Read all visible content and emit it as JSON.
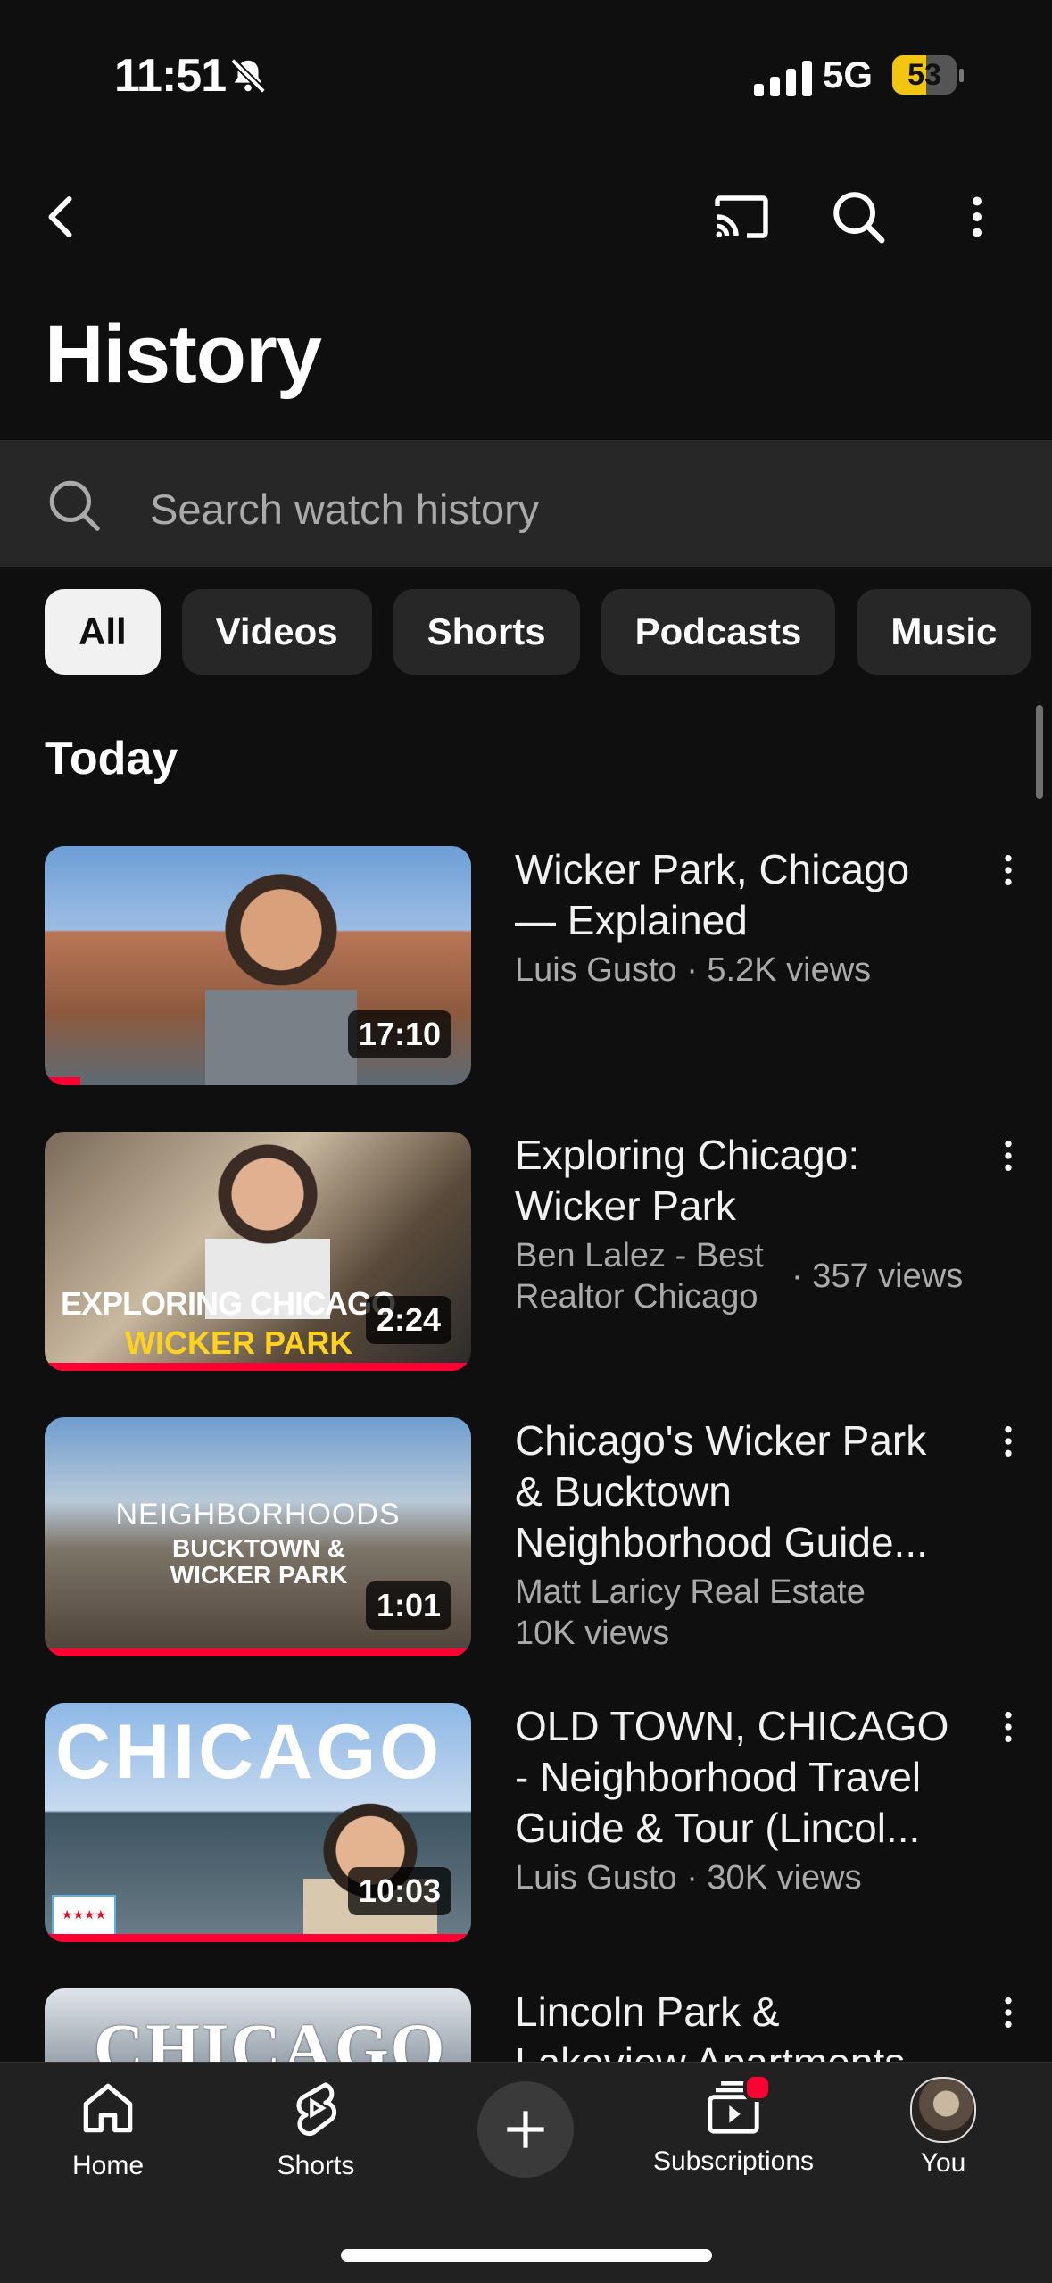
{
  "status_bar": {
    "time": "11:51",
    "network": "5G",
    "battery": "53",
    "battery_level": 0.53
  },
  "header": {
    "title": "History"
  },
  "search": {
    "placeholder": "Search watch history"
  },
  "chips": [
    "All",
    "Videos",
    "Shorts",
    "Podcasts",
    "Music"
  ],
  "section": {
    "today": "Today"
  },
  "videos": [
    {
      "title_line1": "Wicker Park, Chicago",
      "title_line2": "— Explained",
      "title_line3": "",
      "meta1": "Luis Gusto · 5.2K views",
      "meta2": "",
      "duration": "17:10",
      "thumb_text": ""
    },
    {
      "title_line1": "Exploring Chicago:",
      "title_line2": "Wicker Park",
      "title_line3": "",
      "channel_line1": "Ben Lalez - Best",
      "channel_line2": "Realtor Chicago",
      "views": "· 357 views",
      "duration": "2:24",
      "thumb_text": "EXPLORING CHICAGO",
      "thumb_sub": "WICKER PARK"
    },
    {
      "title_line1": "Chicago's Wicker Park",
      "title_line2": "& Bucktown",
      "title_line3": "Neighborhood Guide...",
      "meta1": "Matt Laricy Real Estate",
      "meta2": "10K views",
      "duration": "1:01",
      "thumb_text": "NEIGHBORHOODS",
      "thumb_sub": "BUCKTOWN & WICKER PARK"
    },
    {
      "title_line1": "OLD TOWN, CHICAGO",
      "title_line2": "- Neighborhood Travel",
      "title_line3": "Guide & Tour (Lincol...",
      "meta1": "Luis Gusto · 30K views",
      "meta2": "",
      "duration": "10:03",
      "thumb_text": "CHICAGO"
    },
    {
      "title_line1": "Lincoln Park &",
      "title_line2": "Lakeview Apartments",
      "thumb_text": "CHICAGO"
    }
  ],
  "nav": {
    "home": "Home",
    "shorts": "Shorts",
    "subscriptions": "Subscriptions",
    "you": "You"
  },
  "colors": {
    "background": "#0f0f0f",
    "accent": "#ff0033",
    "chip_bg": "#272727"
  }
}
